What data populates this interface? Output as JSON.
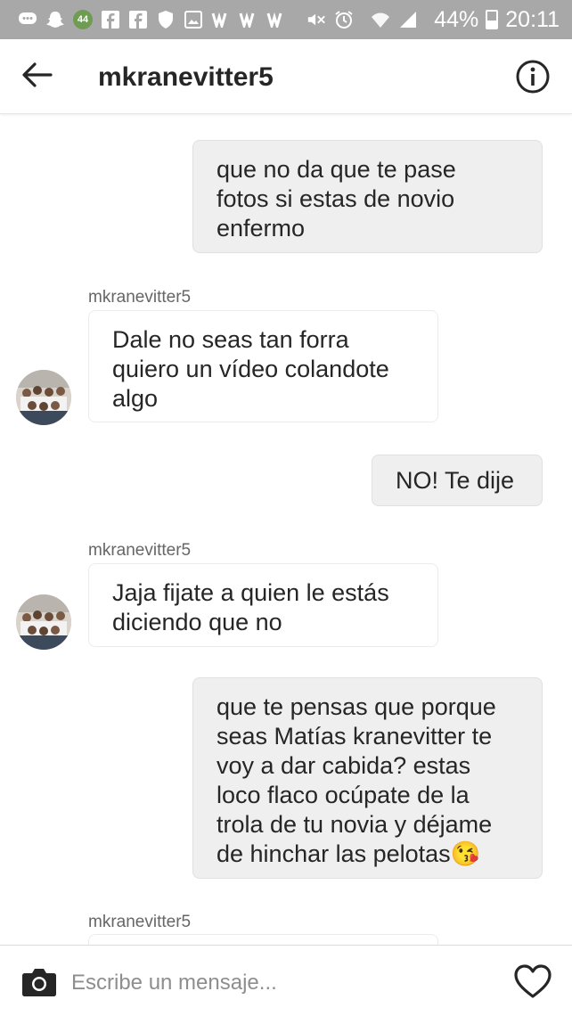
{
  "status_bar": {
    "notification_count": "44",
    "battery": "44%",
    "time": "20:11"
  },
  "header": {
    "title": "mkranevitter5"
  },
  "messages": [
    {
      "direction": "out",
      "text": "que no da que te pase\nfotos si estas de novio\nenfermo"
    },
    {
      "direction": "in",
      "sender": "mkranevitter5",
      "text": "Dale no seas tan forra\nquiero un vídeo colandote\nalgo"
    },
    {
      "direction": "out",
      "text": "NO! Te dije"
    },
    {
      "direction": "in",
      "sender": "mkranevitter5",
      "text": "Jaja fijate a quien le estás\ndiciendo que no"
    },
    {
      "direction": "out",
      "text": "que te pensas que porque\nseas Matías kranevitter te\nvoy a dar cabida? estas\nloco flaco ocúpate de la\ntrola de tu novia y déjame\nde hinchar las pelotas",
      "emoji": "😘"
    },
    {
      "direction": "in",
      "sender": "mkranevitter5",
      "text": ""
    }
  ],
  "composer": {
    "placeholder": "Escribe un mensaje..."
  },
  "icons": [
    "message-icon",
    "snapchat-icon",
    "notification-badge-icon",
    "facebook-icon",
    "facebook-icon",
    "shield-icon",
    "image-icon",
    "flag-icon",
    "flag-icon",
    "flag-icon",
    "mute-icon",
    "alarm-icon",
    "wifi-icon",
    "signal-icon",
    "battery-icon",
    "back-arrow-icon",
    "info-icon",
    "camera-icon",
    "heart-icon"
  ]
}
